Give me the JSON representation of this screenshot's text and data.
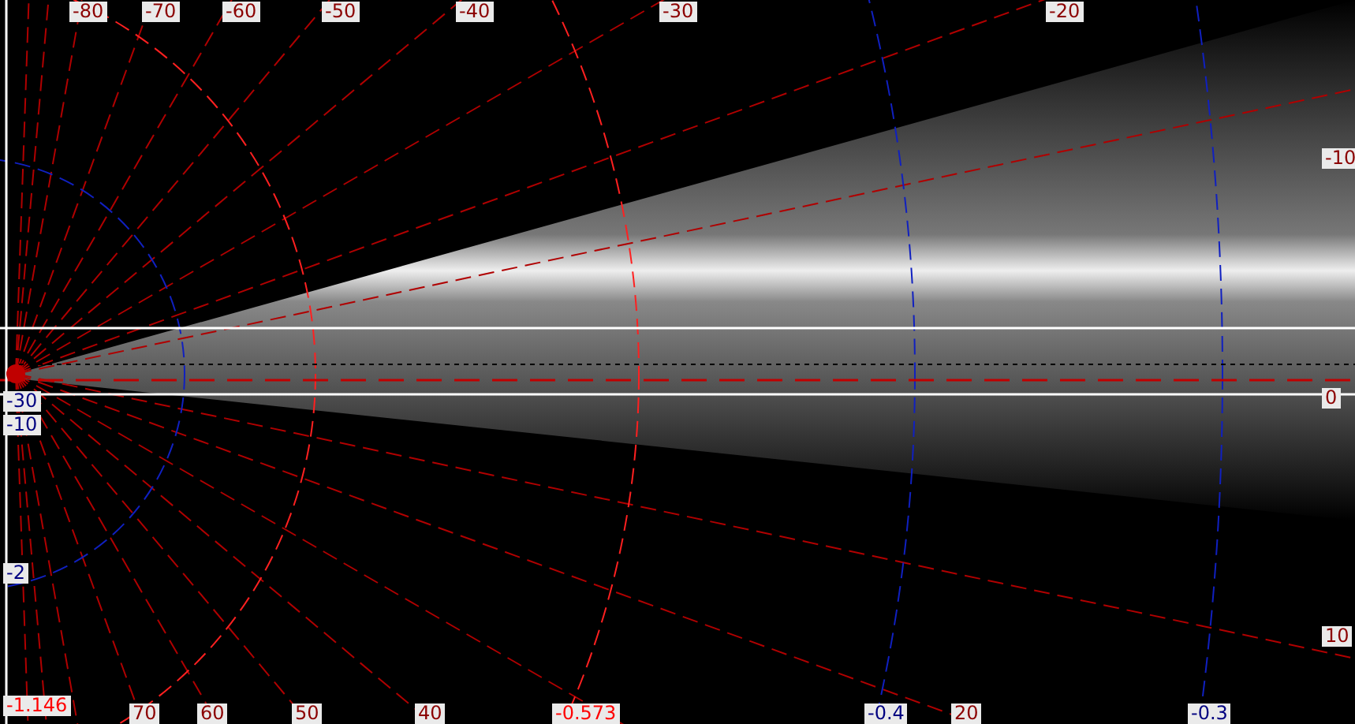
{
  "plot": {
    "labels": [
      {
        "text": "-80",
        "color": "#8b0000"
      },
      {
        "text": "-70",
        "color": "#8b0000"
      },
      {
        "text": "-60",
        "color": "#8b0000"
      },
      {
        "text": "-50",
        "color": "#8b0000"
      },
      {
        "text": "-40",
        "color": "#8b0000"
      },
      {
        "text": "-30",
        "color": "#8b0000"
      },
      {
        "text": "-20",
        "color": "#8b0000"
      },
      {
        "text": "-10",
        "color": "#8b0000"
      },
      {
        "text": "0",
        "color": "#8b0000"
      },
      {
        "text": "10",
        "color": "#8b0000"
      },
      {
        "text": "-30",
        "color": "#000080"
      },
      {
        "text": "-10",
        "color": "#000080"
      },
      {
        "text": "-2",
        "color": "#000080"
      },
      {
        "text": "-1.146",
        "color": "#ff0000"
      },
      {
        "text": "70",
        "color": "#8b0000"
      },
      {
        "text": "60",
        "color": "#8b0000"
      },
      {
        "text": "50",
        "color": "#8b0000"
      },
      {
        "text": "40",
        "color": "#8b0000"
      },
      {
        "text": "-0.573",
        "color": "#ff0000"
      },
      {
        "text": "-0.4",
        "color": "#000080"
      },
      {
        "text": "20",
        "color": "#8b0000"
      },
      {
        "text": "-0.3",
        "color": "#000080"
      }
    ]
  }
}
